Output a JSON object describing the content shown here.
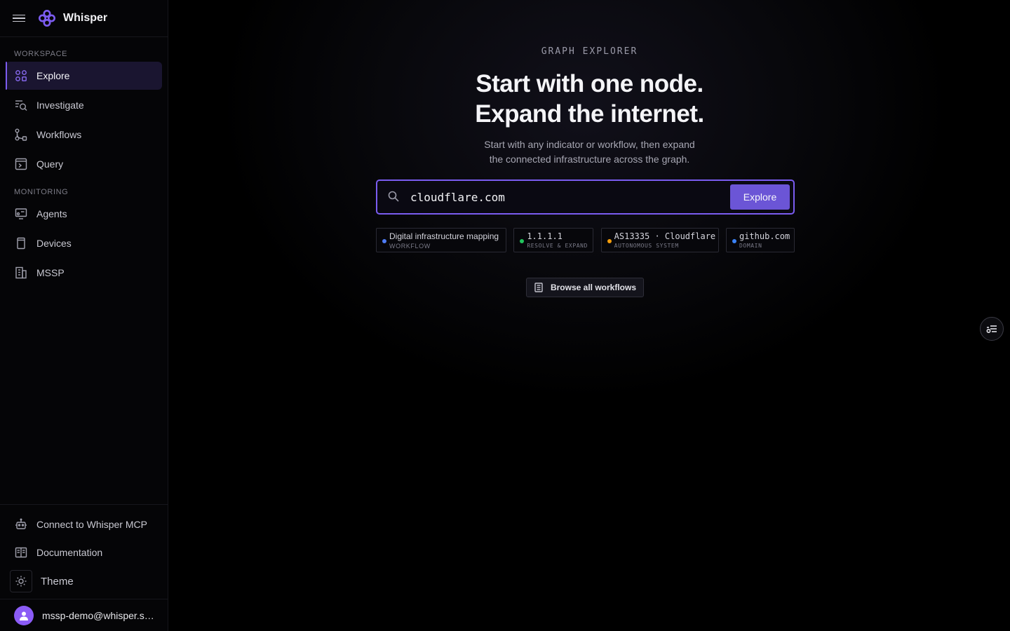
{
  "brand": {
    "name": "Whisper"
  },
  "sidebar": {
    "workspace_label": "WORKSPACE",
    "workspace_items": [
      {
        "label": "Explore",
        "icon": "grid-nodes-icon",
        "active": true
      },
      {
        "label": "Investigate",
        "icon": "list-search-icon"
      },
      {
        "label": "Workflows",
        "icon": "workflow-icon"
      },
      {
        "label": "Query",
        "icon": "terminal-icon"
      }
    ],
    "monitoring_label": "MONITORING",
    "monitoring_items": [
      {
        "label": "Agents",
        "icon": "agent-monitor-icon"
      },
      {
        "label": "Devices",
        "icon": "device-icon"
      },
      {
        "label": "MSSP",
        "icon": "building-icon"
      }
    ],
    "bottom": {
      "mcp_label": "Connect to Whisper MCP",
      "docs_label": "Documentation",
      "theme_label": "Theme",
      "user_email": "mssp-demo@whisper.sec..."
    }
  },
  "main": {
    "eyebrow": "GRAPH EXPLORER",
    "headline_line1": "Start with one node.",
    "headline_line2": "Expand the internet.",
    "sub_line1": "Start with any indicator or workflow, then expand",
    "sub_line2": "the connected infrastructure across the graph.",
    "search": {
      "value": "cloudflare.com",
      "button_label": "Explore"
    },
    "chips": [
      {
        "title": "Digital infrastructure mapping",
        "sub": "WORKFLOW",
        "dot_color": "#4f7cf5"
      },
      {
        "title": "1.1.1.1",
        "sub": "RESOLVE & EXPAND",
        "dot_color": "#22c55e"
      },
      {
        "title": "AS13335 · Cloudflare",
        "sub": "AUTONOMOUS SYSTEM",
        "dot_color": "#f59e0b"
      },
      {
        "title": "github.com",
        "sub": "DOMAIN",
        "dot_color": "#3b82f6"
      }
    ],
    "browse_label": "Browse all workflows"
  },
  "colors": {
    "accent": "#7a5cf0",
    "button": "#6b55d6"
  }
}
